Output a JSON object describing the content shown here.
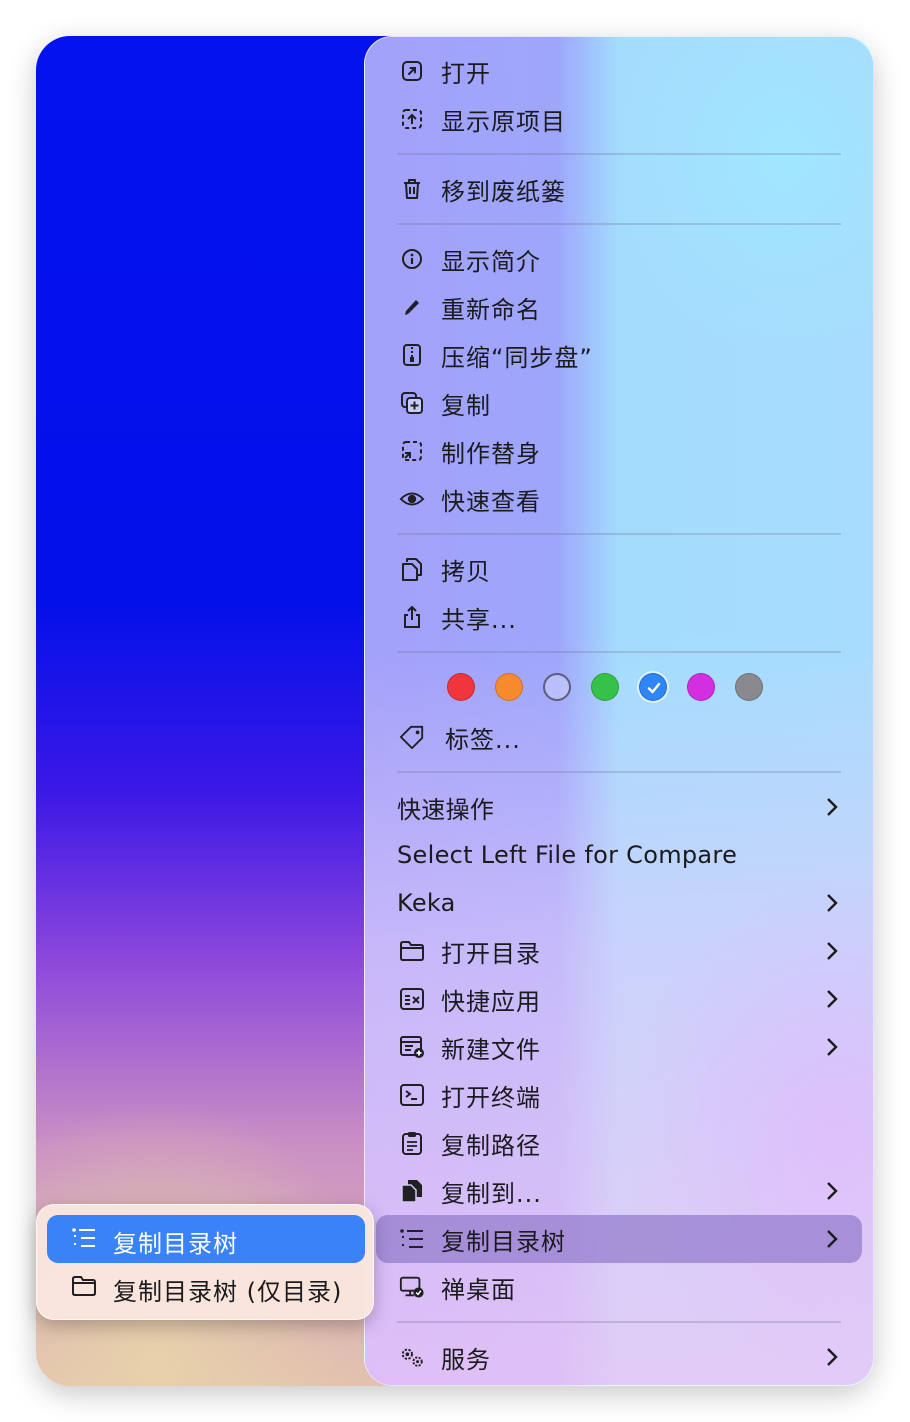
{
  "menu": {
    "groups": [
      [
        {
          "label": "打开",
          "icon": "open-arrow-icon"
        },
        {
          "label": "显示原项目",
          "icon": "show-original-icon"
        }
      ],
      [
        {
          "label": "移到废纸篓",
          "icon": "trash-icon"
        }
      ],
      [
        {
          "label": "显示简介",
          "icon": "info-icon"
        },
        {
          "label": "重新命名",
          "icon": "pencil-icon"
        },
        {
          "label": "压缩“同步盘”",
          "icon": "zip-icon"
        },
        {
          "label": "复制",
          "icon": "duplicate-icon"
        },
        {
          "label": "制作替身",
          "icon": "alias-icon"
        },
        {
          "label": "快速查看",
          "icon": "eye-icon"
        }
      ],
      [
        {
          "label": "拷贝",
          "icon": "copy-icon"
        },
        {
          "label": "共享...",
          "icon": "share-icon"
        }
      ]
    ],
    "tag_colors": [
      "#f0353d",
      "#f88a2e",
      "#ffffff",
      "#36c24a",
      "#2f86f6",
      "#d32ee0",
      "#8a8a8e"
    ],
    "tag_selected_index": 4,
    "tags_label": "标签...",
    "extensions": [
      {
        "label": "快速操作",
        "icon": "",
        "submenu": true
      },
      {
        "label": "Select Left File for Compare",
        "icon": "",
        "submenu": false
      },
      {
        "label": "Keka",
        "icon": "",
        "submenu": true
      },
      {
        "label": "打开目录",
        "icon": "folder-icon",
        "submenu": true
      },
      {
        "label": "快捷应用",
        "icon": "quick-app-icon",
        "submenu": true
      },
      {
        "label": "新建文件",
        "icon": "new-file-icon",
        "submenu": true
      },
      {
        "label": "打开终端",
        "icon": "terminal-icon",
        "submenu": false
      },
      {
        "label": "复制路径",
        "icon": "clipboard-icon",
        "submenu": false
      },
      {
        "label": "复制到...",
        "icon": "copy-to-icon",
        "submenu": true
      },
      {
        "label": "复制目录树",
        "icon": "list-tree-icon",
        "submenu": true,
        "highlighted": true
      },
      {
        "label": "禅桌面",
        "icon": "zen-desktop-icon",
        "submenu": false
      }
    ],
    "services": {
      "label": "服务",
      "icon": "services-icon",
      "submenu": true
    }
  },
  "submenu": {
    "items": [
      {
        "label": "复制目录树",
        "icon": "list-tree-icon",
        "active": true
      },
      {
        "label": "复制目录树 (仅目录)",
        "icon": "folder-icon",
        "active": false
      }
    ]
  }
}
